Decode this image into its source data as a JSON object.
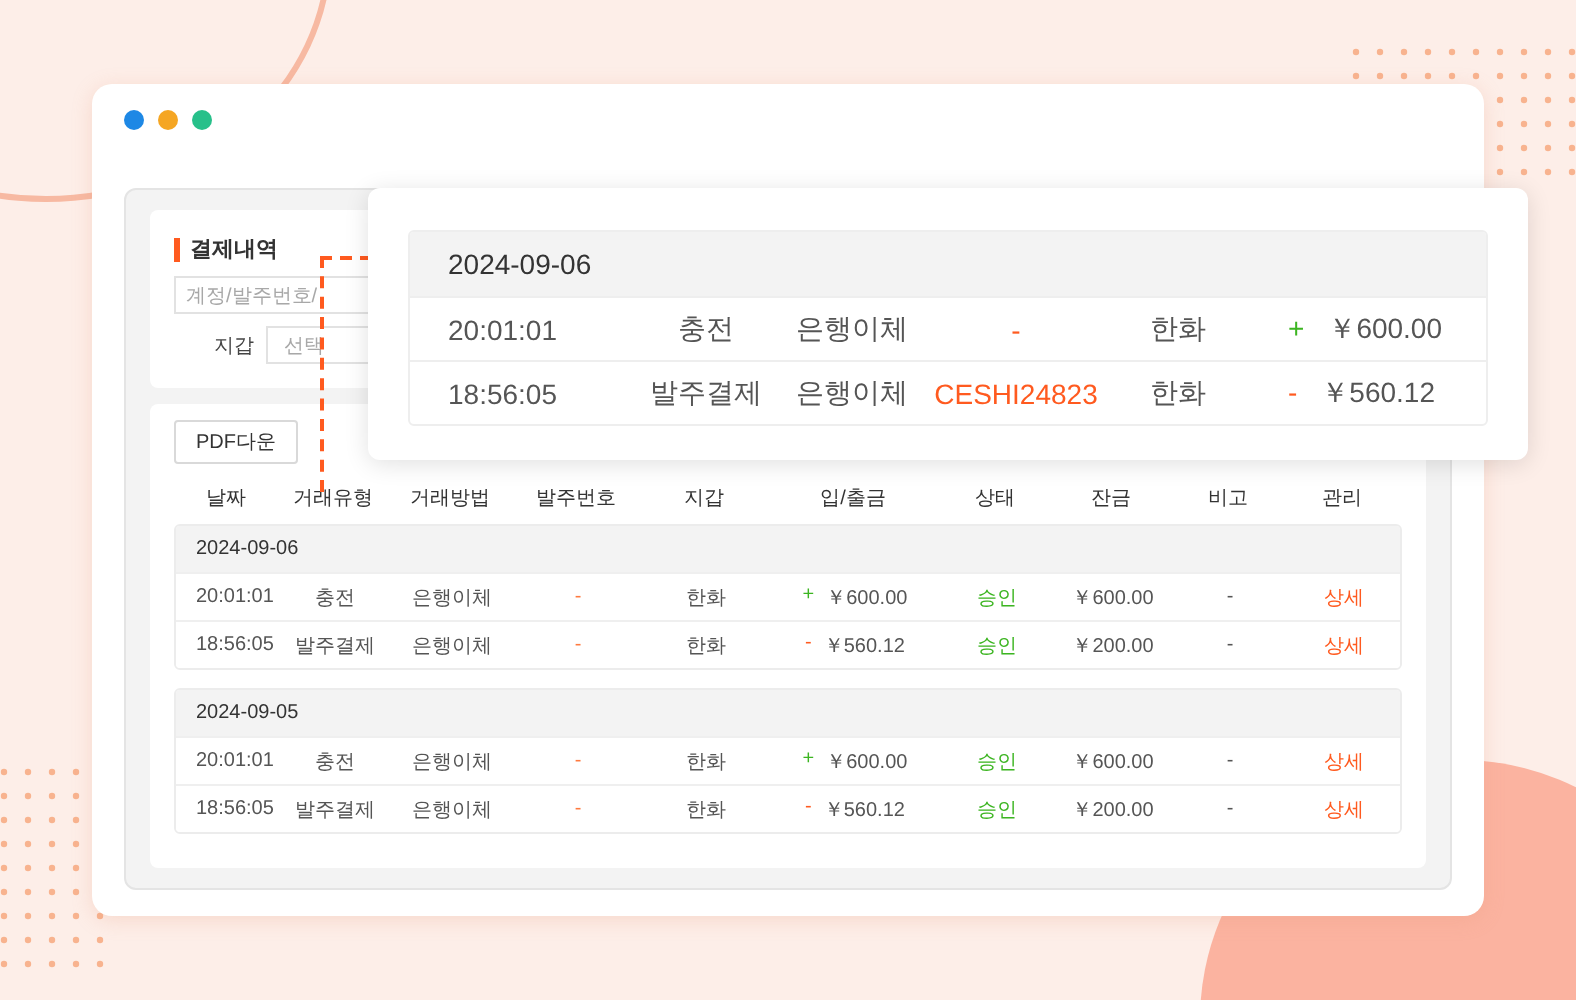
{
  "filter": {
    "title": "결제내역",
    "search_placeholder": "계정/발주번호/",
    "wallet_label": "지갑",
    "wallet_placeholder": "선택"
  },
  "pdf_button": "PDF다운",
  "columns": [
    "날짜",
    "거래유형",
    "거래방법",
    "발주번호",
    "지갑",
    "입/출금",
    "상태",
    "잔금",
    "비고",
    "관리"
  ],
  "groups": [
    {
      "date": "2024-09-06",
      "rows": [
        {
          "time": "20:01:01",
          "type": "충전",
          "method": "은행이체",
          "order": "-",
          "wallet": "한화",
          "sign": "+",
          "color": "#3cb521",
          "amount": "￥600.00",
          "status": "승인",
          "balance": "￥600.00",
          "note": "-",
          "action": "상세"
        },
        {
          "time": "18:56:05",
          "type": "발주결제",
          "method": "은행이체",
          "order": "-",
          "wallet": "한화",
          "sign": "-",
          "color": "#ff5a1f",
          "amount": "￥560.12",
          "status": "승인",
          "balance": "￥200.00",
          "note": "-",
          "action": "상세"
        }
      ]
    },
    {
      "date": "2024-09-05",
      "rows": [
        {
          "time": "20:01:01",
          "type": "충전",
          "method": "은행이체",
          "order": "-",
          "wallet": "한화",
          "sign": "+",
          "color": "#3cb521",
          "amount": "￥600.00",
          "status": "승인",
          "balance": "￥600.00",
          "note": "-",
          "action": "상세"
        },
        {
          "time": "18:56:05",
          "type": "발주결제",
          "method": "은행이체",
          "order": "-",
          "wallet": "한화",
          "sign": "-",
          "color": "#ff5a1f",
          "amount": "￥560.12",
          "status": "승인",
          "balance": "￥200.00",
          "note": "-",
          "action": "상세"
        }
      ]
    }
  ],
  "popup": {
    "date": "2024-09-06",
    "rows": [
      {
        "time": "20:01:01",
        "type": "충전",
        "method": "은행이체",
        "order": "-",
        "wallet": "한화",
        "sign": "+",
        "color": "#3cb521",
        "amount": "￥600.00"
      },
      {
        "time": "18:56:05",
        "type": "발주결제",
        "method": "은행이체",
        "order": "CESHI24823",
        "wallet": "한화",
        "sign": "-",
        "color": "#ff5a1f",
        "amount": "￥560.12"
      }
    ]
  }
}
